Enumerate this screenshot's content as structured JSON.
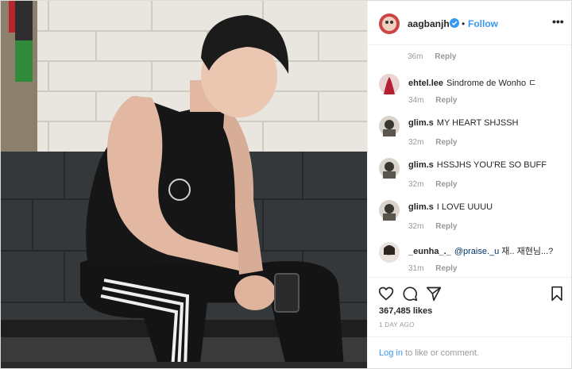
{
  "header": {
    "username": "aagbanjh",
    "separator": "•",
    "follow_label": "Follow",
    "more_label": "•••"
  },
  "first_comment_meta": {
    "time": "36m",
    "reply": "Reply"
  },
  "comments": [
    {
      "username": "ehtel.lee",
      "text": "Sindrome de Wonho ㄷ",
      "time": "34m",
      "reply": "Reply"
    },
    {
      "username": "glim.s",
      "text": "MY HEART SHJSSH",
      "time": "32m",
      "reply": "Reply"
    },
    {
      "username": "glim.s",
      "text": "HSSJHS YOU'RE SO BUFF",
      "time": "32m",
      "reply": "Reply"
    },
    {
      "username": "glim.s",
      "text": "I LOVE UUUU",
      "time": "32m",
      "reply": "Reply"
    },
    {
      "username": "_eunha_._",
      "mention": "@praise._u",
      "text": "재.. 재현님...?",
      "time": "31m",
      "reply": "Reply"
    }
  ],
  "actions": {
    "likes": "367,485 likes",
    "time_ago": "1 DAY AGO",
    "login_link": "Log in",
    "login_rest": " to like or comment."
  },
  "icons": [
    "heart-icon",
    "comment-icon",
    "share-icon",
    "bookmark-icon",
    "verified-icon",
    "more-icon"
  ],
  "colors": {
    "link_blue": "#3897f0",
    "text": "#262626",
    "muted": "#999999",
    "border": "#efefef"
  }
}
